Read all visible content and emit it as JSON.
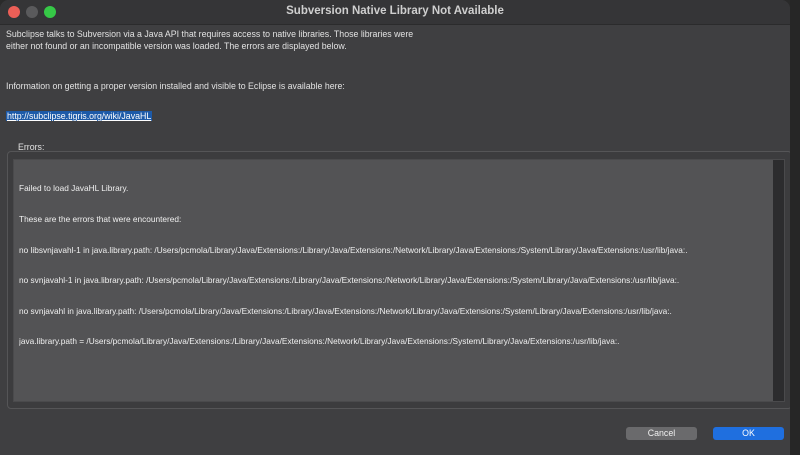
{
  "window": {
    "title": "Subversion Native Library Not Available"
  },
  "dialog": {
    "intro": "Subclipse talks to Subversion via a Java API that requires access to native libraries.  Those libraries were either not found or an incompatible version was loaded.  The errors are displayed below.",
    "info": "Information on getting a proper version installed and visible to Eclipse is available here:",
    "link": "http://subclipse.tigris.org/wiki/JavaHL",
    "errors_label": "Errors:",
    "errors_lines": [
      "Failed to load JavaHL Library.",
      "These are the errors that were encountered:",
      "no libsvnjavahl-1 in java.library.path: /Users/pcmola/Library/Java/Extensions:/Library/Java/Extensions:/Network/Library/Java/Extensions:/System/Library/Java/Extensions:/usr/lib/java:.",
      "no svnjavahl-1 in java.library.path: /Users/pcmola/Library/Java/Extensions:/Library/Java/Extensions:/Network/Library/Java/Extensions:/System/Library/Java/Extensions:/usr/lib/java:.",
      "no svnjavahl in java.library.path: /Users/pcmola/Library/Java/Extensions:/Library/Java/Extensions:/Network/Library/Java/Extensions:/System/Library/Java/Extensions:/usr/lib/java:.",
      "java.library.path = /Users/pcmola/Library/Java/Extensions:/Library/Java/Extensions:/Network/Library/Java/Extensions:/System/Library/Java/Extensions:/usr/lib/java:."
    ],
    "cancel_label": "Cancel",
    "ok_label": "OK"
  },
  "colors": {
    "accent": "#1f6fdf",
    "dialog_bg": "#3f3f41",
    "close": "#ec5f57",
    "maximize": "#36c847"
  }
}
